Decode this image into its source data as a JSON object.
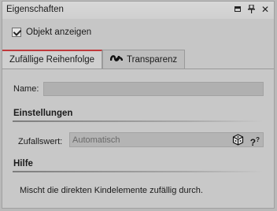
{
  "window": {
    "title": "Eigenschaften",
    "icons": [
      "restore-icon",
      "pin-icon",
      "close-icon"
    ]
  },
  "object_display": {
    "label": "Objekt anzeigen",
    "checked": true
  },
  "tabs": [
    {
      "label": "Zufällige Reihenfolge",
      "active": true
    },
    {
      "label": "Transparenz",
      "active": false,
      "icon": "transparency-icon"
    }
  ],
  "form": {
    "name_label": "Name:",
    "name_value": "",
    "settings_heading": "Einstellungen",
    "random_label": "Zufallswert:",
    "random_placeholder": "Automatisch",
    "help_glyph": "?",
    "help_heading": "Hilfe",
    "help_text": "Mischt die direkten Kindelemente zufällig durch."
  },
  "colors": {
    "accent": "#c0393b",
    "panel_bg": "#c6c6c6"
  }
}
